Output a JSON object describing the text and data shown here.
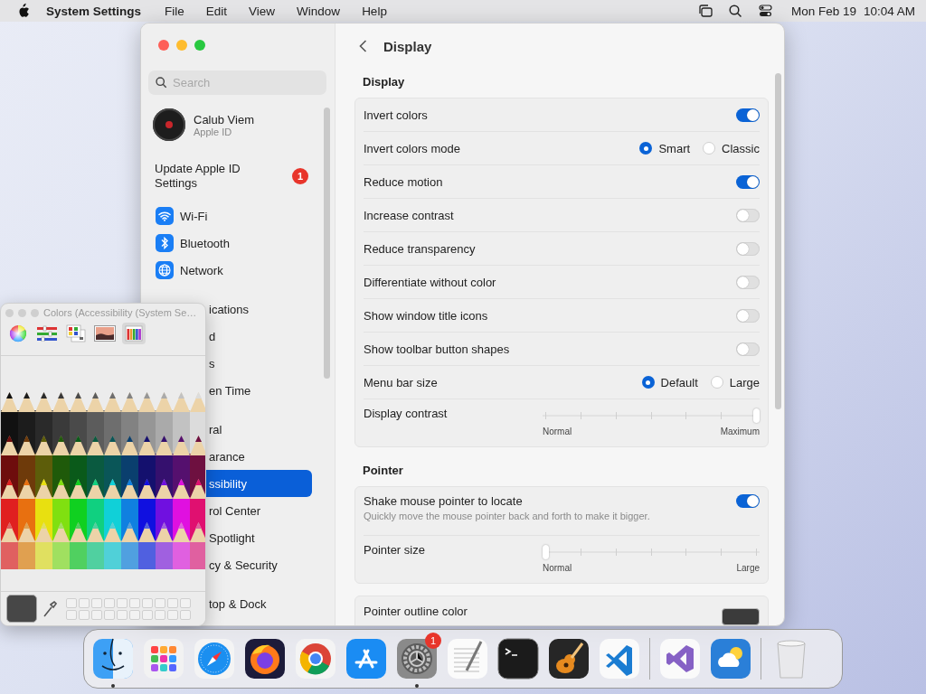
{
  "menu_bar": {
    "app": "System Settings",
    "menus": [
      "File",
      "Edit",
      "View",
      "Window",
      "Help"
    ],
    "date": "Mon Feb 19",
    "time": "10:04 AM"
  },
  "settings_window": {
    "title": "Display",
    "sidebar": {
      "search_placeholder": "Search",
      "account": {
        "name": "Calub Viem",
        "subtitle": "Apple ID"
      },
      "update": {
        "label": "Update Apple ID Settings",
        "badge": "1"
      },
      "groups": [
        {
          "items": [
            {
              "label": "Wi-Fi",
              "kind": "wifi",
              "covered": false,
              "selected": false
            },
            {
              "label": "Bluetooth",
              "kind": "bluetooth",
              "covered": false,
              "selected": false
            },
            {
              "label": "Network",
              "kind": "network",
              "covered": false,
              "selected": false
            }
          ]
        },
        {
          "items": [
            {
              "label": "ications",
              "covered": true,
              "selected": false
            },
            {
              "label": "d",
              "covered": true,
              "selected": false
            },
            {
              "label": "s",
              "covered": true,
              "selected": false
            },
            {
              "label": "en Time",
              "covered": true,
              "selected": false
            }
          ]
        },
        {
          "items": [
            {
              "label": "ral",
              "covered": true,
              "selected": false
            },
            {
              "label": "arance",
              "covered": true,
              "selected": false
            },
            {
              "label": "ssibility",
              "covered": true,
              "selected": true
            },
            {
              "label": "rol Center",
              "covered": true,
              "selected": false
            },
            {
              "label": "Spotlight",
              "covered": true,
              "selected": false
            },
            {
              "label": "cy & Security",
              "covered": true,
              "selected": false
            }
          ]
        },
        {
          "items": [
            {
              "label": "top & Dock",
              "covered": true,
              "selected": false
            }
          ]
        }
      ]
    },
    "sections": [
      {
        "heading": "Display",
        "rows": [
          {
            "kind": "toggle",
            "label": "Invert colors",
            "on": true
          },
          {
            "kind": "radio",
            "label": "Invert colors mode",
            "options": [
              {
                "label": "Smart",
                "selected": true
              },
              {
                "label": "Classic",
                "selected": false
              }
            ]
          },
          {
            "kind": "toggle",
            "label": "Reduce motion",
            "on": true
          },
          {
            "kind": "toggle",
            "label": "Increase contrast",
            "on": false
          },
          {
            "kind": "toggle",
            "label": "Reduce transparency",
            "on": false
          },
          {
            "kind": "toggle",
            "label": "Differentiate without color",
            "on": false
          },
          {
            "kind": "toggle",
            "label": "Show window title icons",
            "on": false
          },
          {
            "kind": "toggle",
            "label": "Show toolbar button shapes",
            "on": false
          },
          {
            "kind": "radio",
            "label": "Menu bar size",
            "options": [
              {
                "label": "Default",
                "selected": true
              },
              {
                "label": "Large",
                "selected": false
              }
            ]
          },
          {
            "kind": "slider",
            "label": "Display contrast",
            "level": 1,
            "min_label": "Normal",
            "max_label": "Maximum"
          }
        ]
      },
      {
        "heading": "Pointer",
        "rows": [
          {
            "kind": "toggle",
            "label": "Shake mouse pointer to locate",
            "description": "Quickly move the mouse pointer back and forth to make it bigger.",
            "on": true
          },
          {
            "kind": "slider",
            "label": "Pointer size",
            "level": 0,
            "min_label": "Normal",
            "max_label": "Large"
          }
        ]
      },
      {
        "rows": [
          {
            "kind": "color_well",
            "label": "Pointer outline color"
          }
        ]
      }
    ]
  },
  "colors_panel": {
    "title": "Colors (Accessibility (System Se…",
    "tabs": [
      {
        "kind": "wheel",
        "selected": false
      },
      {
        "kind": "sliders",
        "selected": false
      },
      {
        "kind": "palettes",
        "selected": false
      },
      {
        "kind": "image",
        "selected": false
      },
      {
        "kind": "pencils",
        "selected": true
      }
    ]
  },
  "dock": {
    "apps": [
      {
        "kind": "finder",
        "running": true
      },
      {
        "kind": "launchpad",
        "running": false
      },
      {
        "kind": "safari",
        "running": false
      },
      {
        "kind": "firefox",
        "running": false
      },
      {
        "kind": "chrome",
        "running": false
      },
      {
        "kind": "appstore",
        "running": false
      },
      {
        "kind": "settings",
        "running": true,
        "badge": "1"
      },
      {
        "kind": "textedit",
        "running": false
      },
      {
        "kind": "terminal",
        "running": false
      },
      {
        "kind": "garageband",
        "running": false
      },
      {
        "kind": "vscode",
        "running": false
      }
    ],
    "recent": [
      {
        "kind": "visualstudio",
        "running": false
      },
      {
        "kind": "weather",
        "running": false
      }
    ]
  }
}
